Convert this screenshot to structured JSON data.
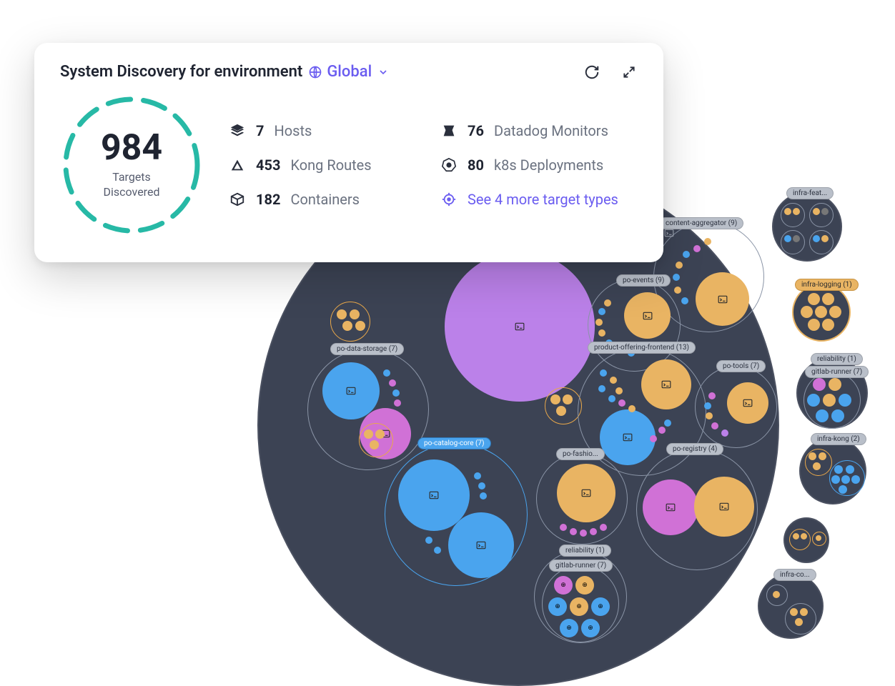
{
  "card": {
    "title": "System Discovery for environment",
    "env_label": "Global",
    "targets_count": "984",
    "targets_label": "Targets\nDiscovered",
    "stats": {
      "hosts": {
        "count": "7",
        "label": "Hosts"
      },
      "kong_routes": {
        "count": "453",
        "label": "Kong Routes"
      },
      "containers": {
        "count": "182",
        "label": "Containers"
      },
      "datadog": {
        "count": "76",
        "label": "Datadog Monitors"
      },
      "k8s": {
        "count": "80",
        "label": "k8s Deployments"
      }
    },
    "more_link": "See 4 more target types"
  },
  "viz": {
    "groups": {
      "content_aggregator": "content-aggregator (9)",
      "po_events": "po-events (9)",
      "po_data_storage": "po-data-storage (7)",
      "product_offering_frontend": "product-offering-frontend (13)",
      "po_tools": "po-tools (7)",
      "po_catalog_core": "po-catalog-core (7)",
      "po_fashion": "po-fashio...",
      "po_registry": "po-registry (4)",
      "reliability_main": "reliability (1)",
      "gitlab_runner_main": "gitlab-runner (7)"
    },
    "side": {
      "infra_feat": "infra-feat...",
      "infra_logging": "infra-logging (1)",
      "reliability": "reliability (1)",
      "gitlab_runner": "gitlab-runner (7)",
      "infra_kong": "infra-kong (2)",
      "infra_co": "infra-co..."
    }
  },
  "colors": {
    "accent": "#6a5cf0",
    "teal": "#27b9a6",
    "dark": "#3c4354"
  }
}
